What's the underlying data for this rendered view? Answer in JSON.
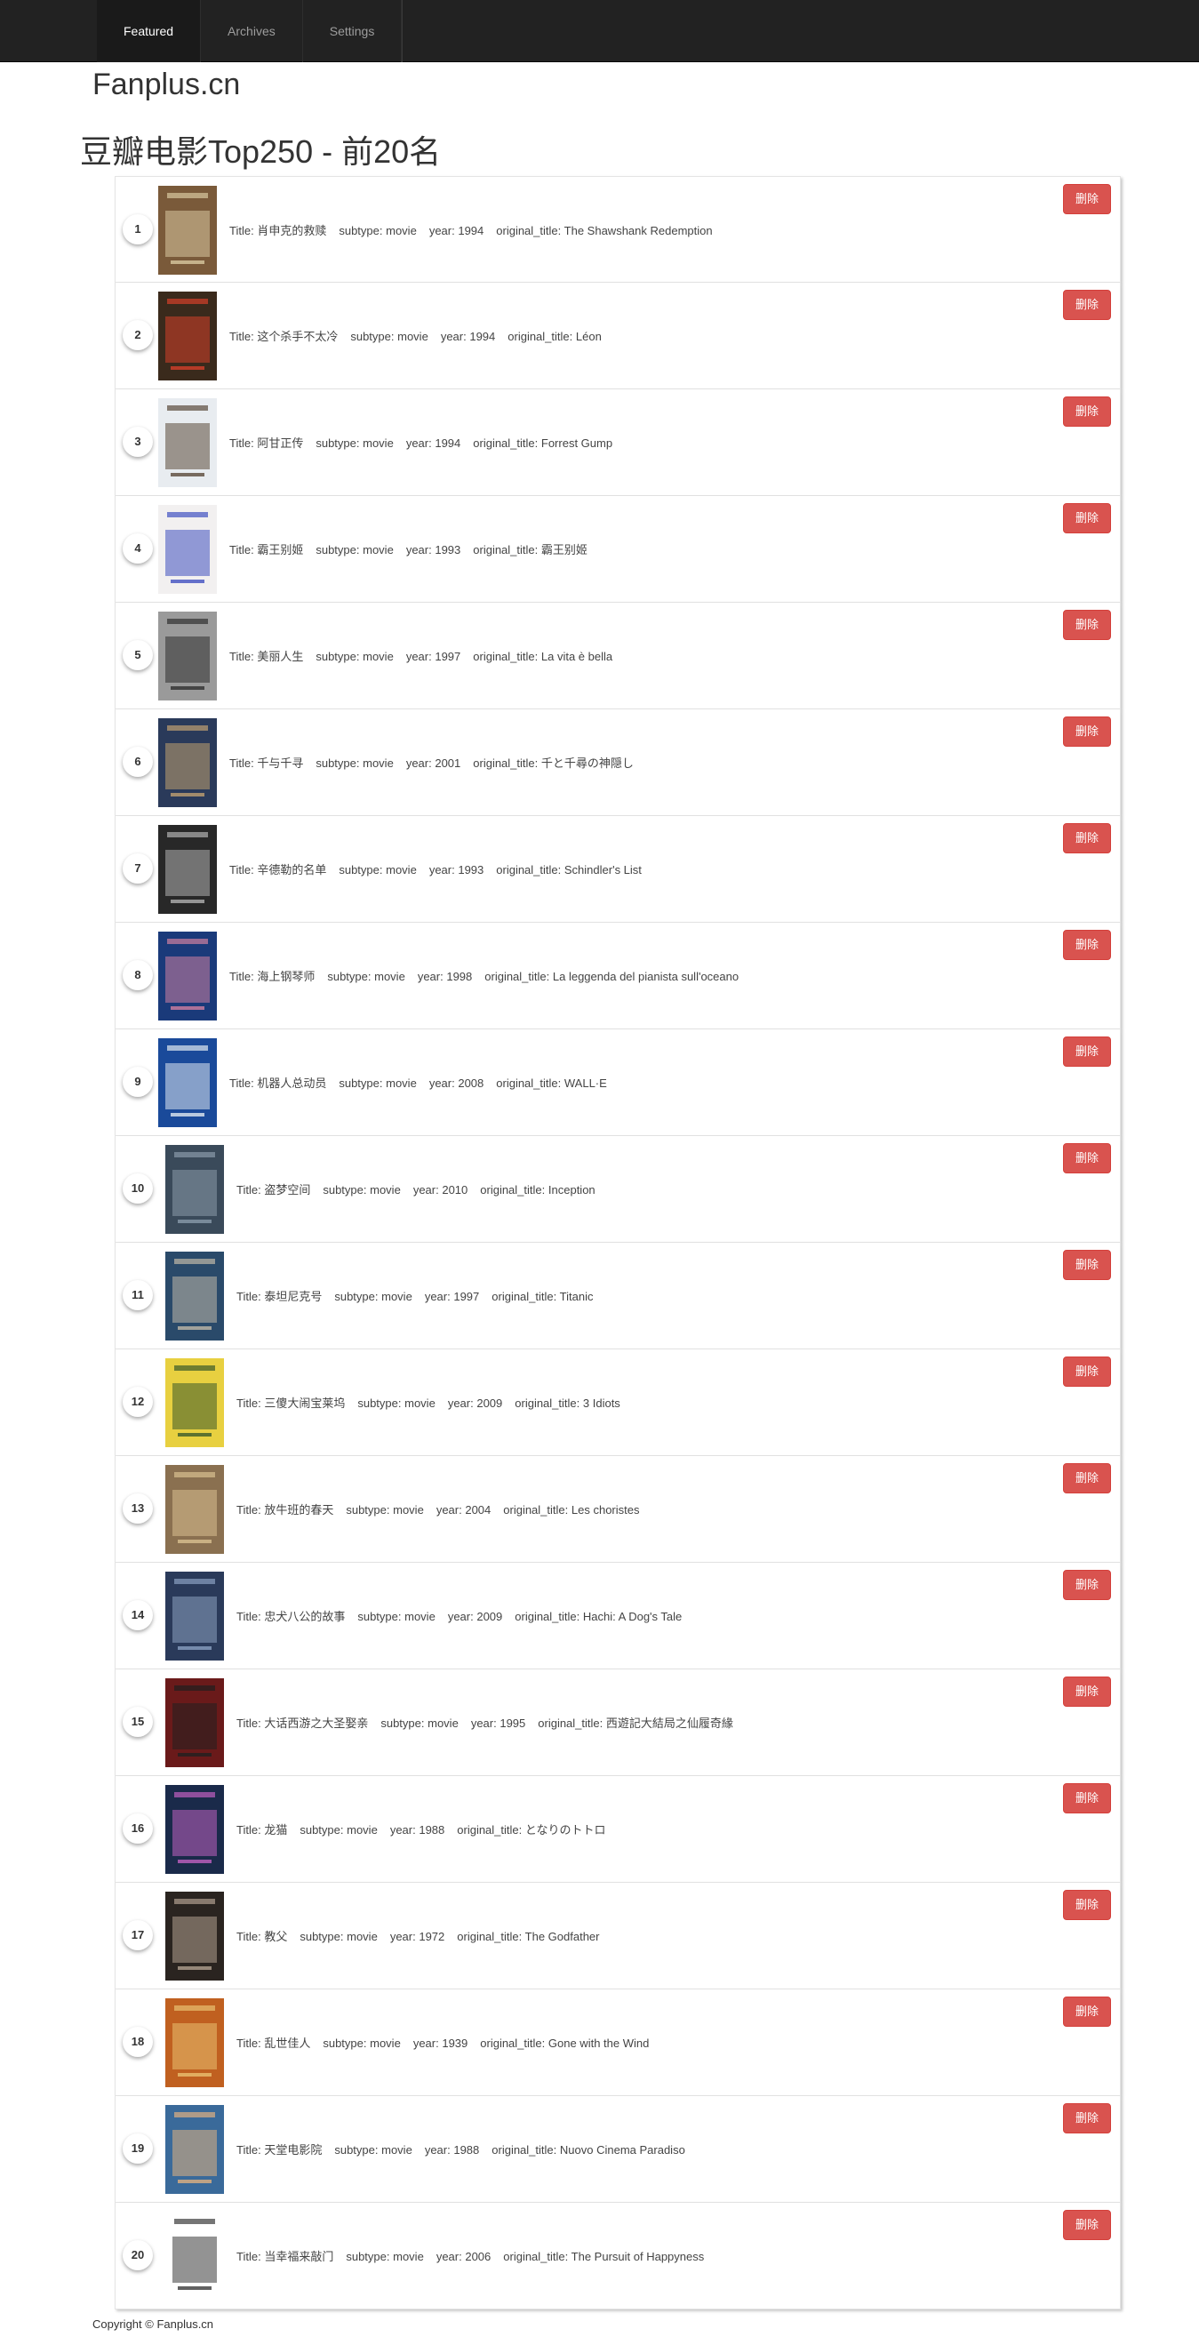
{
  "nav": {
    "tabs": [
      {
        "label": "Featured",
        "active": true
      },
      {
        "label": "Archives",
        "active": false
      },
      {
        "label": "Settings",
        "active": false
      }
    ]
  },
  "brand": "Fanplus.cn",
  "page_title": "豆瓣电影Top250 - 前20名",
  "labels": {
    "title": "Title:",
    "subtype": "subtype:",
    "year": "year:",
    "original_title": "original_title:",
    "delete": "删除"
  },
  "movies": [
    {
      "rank": "1",
      "title": "肖申克的救赎",
      "subtype": "movie",
      "year": "1994",
      "original_title": "The Shawshank Redemption",
      "poster_color": "#7a5a3a",
      "poster_accent": "#d8c8a0"
    },
    {
      "rank": "2",
      "title": "这个杀手不太冷",
      "subtype": "movie",
      "year": "1994",
      "original_title": "Léon",
      "poster_color": "#3a2a1c",
      "poster_accent": "#d4402a"
    },
    {
      "rank": "3",
      "title": "阿甘正传",
      "subtype": "movie",
      "year": "1994",
      "original_title": "Forrest Gump",
      "poster_color": "#e8ecf0",
      "poster_accent": "#5a4a3a"
    },
    {
      "rank": "4",
      "title": "霸王别姬",
      "subtype": "movie",
      "year": "1993",
      "original_title": "霸王别姬",
      "poster_color": "#f2f0f0",
      "poster_accent": "#4050c0"
    },
    {
      "rank": "5",
      "title": "美丽人生",
      "subtype": "movie",
      "year": "1997",
      "original_title": "La vita è bella",
      "poster_color": "#9a9a9a",
      "poster_accent": "#303030"
    },
    {
      "rank": "6",
      "title": "千与千寻",
      "subtype": "movie",
      "year": "2001",
      "original_title": "千と千尋の神隠し",
      "poster_color": "#2a3a5a",
      "poster_accent": "#c0a070"
    },
    {
      "rank": "7",
      "title": "辛德勒的名单",
      "subtype": "movie",
      "year": "1993",
      "original_title": "Schindler's List",
      "poster_color": "#282828",
      "poster_accent": "#b0b0b0"
    },
    {
      "rank": "8",
      "title": "海上钢琴师",
      "subtype": "movie",
      "year": "1998",
      "original_title": "La leggenda del pianista sull'oceano",
      "poster_color": "#1a3a7a",
      "poster_accent": "#d080a0"
    },
    {
      "rank": "9",
      "title": "机器人总动员",
      "subtype": "movie",
      "year": "2008",
      "original_title": "WALL·E",
      "poster_color": "#1a4a9a",
      "poster_accent": "#e0e8f0"
    },
    {
      "rank": "10",
      "title": "盗梦空间",
      "subtype": "movie",
      "year": "2010",
      "original_title": "Inception",
      "poster_color": "#3a4a5a",
      "poster_accent": "#8a9aaa"
    },
    {
      "rank": "11",
      "title": "泰坦尼克号",
      "subtype": "movie",
      "year": "1997",
      "original_title": "Titanic",
      "poster_color": "#2a4a6a",
      "poster_accent": "#c0b8a8"
    },
    {
      "rank": "12",
      "title": "三傻大闹宝莱坞",
      "subtype": "movie",
      "year": "2009",
      "original_title": "3 Idiots",
      "poster_color": "#e8d040",
      "poster_accent": "#3a5a2a"
    },
    {
      "rank": "13",
      "title": "放牛班的春天",
      "subtype": "movie",
      "year": "2004",
      "original_title": "Les choristes",
      "poster_color": "#8a7050",
      "poster_accent": "#d8c090"
    },
    {
      "rank": "14",
      "title": "忠犬八公的故事",
      "subtype": "movie",
      "year": "2009",
      "original_title": "Hachi: A Dog's Tale",
      "poster_color": "#2a3a5a",
      "poster_accent": "#8aa0c0"
    },
    {
      "rank": "15",
      "title": "大话西游之大圣娶亲",
      "subtype": "movie",
      "year": "1995",
      "original_title": "西遊記大結局之仙履奇緣",
      "poster_color": "#6a1a1a",
      "poster_accent": "#202020"
    },
    {
      "rank": "16",
      "title": "龙猫",
      "subtype": "movie",
      "year": "1988",
      "original_title": "となりのトトロ",
      "poster_color": "#1a2a4a",
      "poster_accent": "#c060c0"
    },
    {
      "rank": "17",
      "title": "教父",
      "subtype": "movie",
      "year": "1972",
      "original_title": "The Godfather",
      "poster_color": "#2a2420",
      "poster_accent": "#b0a090"
    },
    {
      "rank": "18",
      "title": "乱世佳人",
      "subtype": "movie",
      "year": "1939",
      "original_title": "Gone with the Wind",
      "poster_color": "#c06020",
      "poster_accent": "#e8c070"
    },
    {
      "rank": "19",
      "title": "天堂电影院",
      "subtype": "movie",
      "year": "1988",
      "original_title": "Nuovo Cinema Paradiso",
      "poster_color": "#3a6a9a",
      "poster_accent": "#e0b080"
    },
    {
      "rank": "20",
      "title": "当幸福来敲门",
      "subtype": "movie",
      "year": "2006",
      "original_title": "The Pursuit of Happyness",
      "poster_color": "#ffffff",
      "poster_accent": "#3a3a3a"
    }
  ],
  "footer": "Copyright © Fanplus.cn",
  "colors": {
    "navbar_bg": "#222222",
    "delete_button": "#d9534f"
  }
}
